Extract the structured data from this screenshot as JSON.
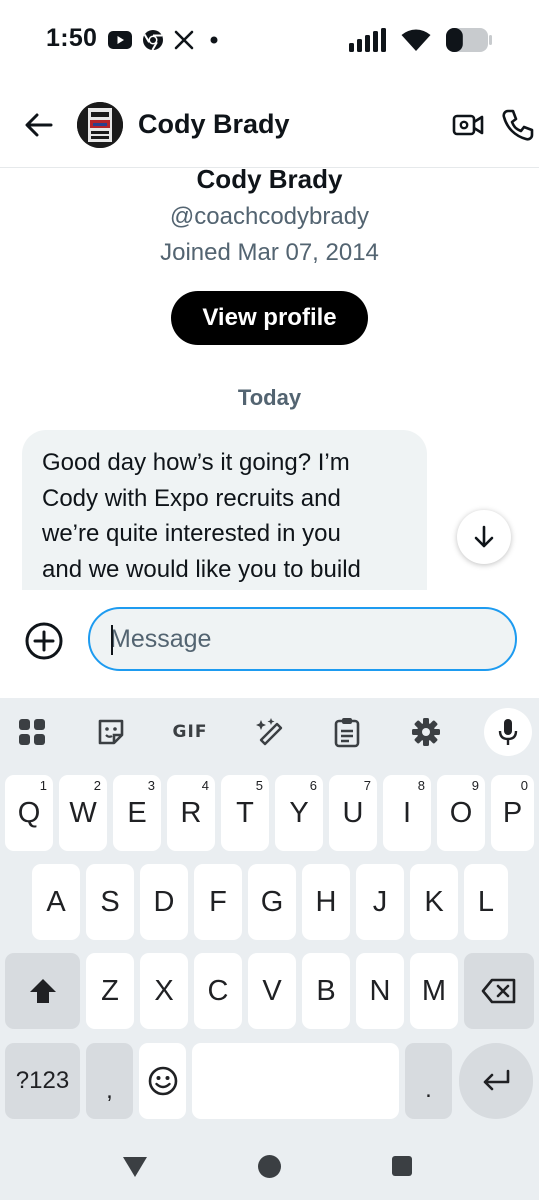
{
  "status_bar": {
    "time": "1:50",
    "left_icons": [
      "youtube-icon",
      "chrome-icon",
      "x-icon",
      "dot-icon"
    ],
    "right_icons": [
      "signal-icon",
      "wifi-icon",
      "battery-icon"
    ],
    "battery_level": 0.4
  },
  "header": {
    "name": "Cody Brady",
    "icons": [
      "back-arrow-icon",
      "video-call-icon",
      "phone-icon"
    ]
  },
  "profile": {
    "name": "Cody Brady",
    "handle": "@coachcodybrady",
    "joined": "Joined Mar 07, 2014",
    "view_profile_label": "View profile"
  },
  "conversation": {
    "day_label": "Today",
    "message_lines": [
      "Good day how’s it going? I’m",
      "Cody with Expo recruits and",
      "we’re quite interested in you",
      "and we would like you to build"
    ]
  },
  "composer": {
    "placeholder": "Message",
    "value": ""
  },
  "keyboard": {
    "toolbar_gif_label": "GIF",
    "toolbar_icons": [
      "apps-grid-icon",
      "sticker-icon",
      "gif-icon",
      "magic-wand-icon",
      "clipboard-icon",
      "settings-icon",
      "mic-icon"
    ],
    "row1": [
      {
        "key": "Q",
        "hint": "1"
      },
      {
        "key": "W",
        "hint": "2"
      },
      {
        "key": "E",
        "hint": "3"
      },
      {
        "key": "R",
        "hint": "4"
      },
      {
        "key": "T",
        "hint": "5"
      },
      {
        "key": "Y",
        "hint": "6"
      },
      {
        "key": "U",
        "hint": "7"
      },
      {
        "key": "I",
        "hint": "8"
      },
      {
        "key": "O",
        "hint": "9"
      },
      {
        "key": "P",
        "hint": "0"
      }
    ],
    "row2": [
      "A",
      "S",
      "D",
      "F",
      "G",
      "H",
      "J",
      "K",
      "L"
    ],
    "row3": [
      "Z",
      "X",
      "C",
      "V",
      "B",
      "N",
      "M"
    ],
    "symbols_label": "?123",
    "comma_label": ",",
    "period_label": "."
  },
  "colors": {
    "accent": "#1d9bf0",
    "text_primary": "#0f1419",
    "text_secondary": "#536471",
    "bubble_bg": "#eff3f4",
    "keyboard_bg": "#eaeef1"
  }
}
